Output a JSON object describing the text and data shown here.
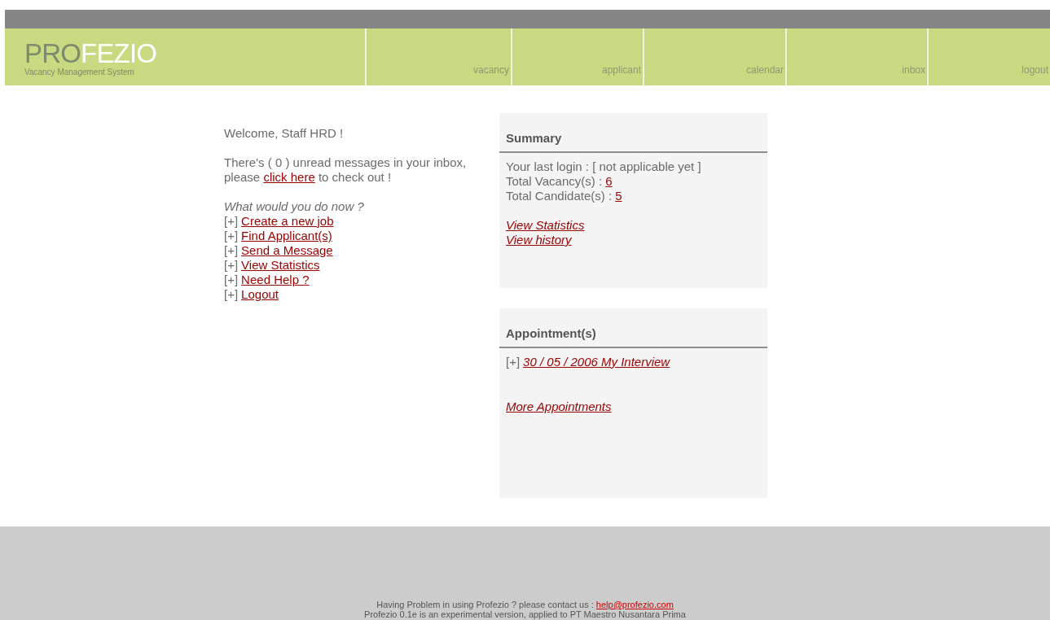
{
  "header": {
    "logo_dark": "PRO",
    "logo_light": "FEZIO",
    "subtitle": "Vacancy Management System",
    "nav": [
      {
        "label": "vacancy"
      },
      {
        "label": "applicant"
      },
      {
        "label": "calendar"
      },
      {
        "label": "inbox"
      },
      {
        "label": "logout"
      }
    ]
  },
  "welcome": "Welcome, Staff HRD !",
  "inbox_note": {
    "before": "There's ( 0 ) unread messages in your inbox, please ",
    "link": "click here",
    "after": " to check out !"
  },
  "actions_title": "What would you do now ?",
  "actions": [
    {
      "marker": "[+]",
      "label": "Create a new job"
    },
    {
      "marker": "[+]",
      "label": "Find Applicant(s)"
    },
    {
      "marker": "[+]",
      "label": "Send a Message"
    },
    {
      "marker": "[+]",
      "label": "View Statistics"
    },
    {
      "marker": "[+]",
      "label": "Need Help ?"
    },
    {
      "marker": "[+]",
      "label": "Logout"
    }
  ],
  "summary": {
    "title": "Summary",
    "last_login": "Your last login : [ not applicable yet ]",
    "stats": [
      {
        "label": "Total Vacancy(s) : ",
        "value": "6"
      },
      {
        "label": "Total Candidate(s) : ",
        "value": "5"
      }
    ],
    "links": [
      "View Statistics",
      "View history"
    ]
  },
  "appointments": {
    "title": "Appointment(s)",
    "items": [
      {
        "marker": "[+]",
        "label": "30 / 05 / 2006 My Interview"
      }
    ],
    "more": "More Appointments"
  },
  "footer": {
    "contact": "Having Problem in using Profezio ? please contact us : ",
    "email": "help@profezio.com",
    "note": "Profezio 0.1e is an experimental version, applied to PT Maestro Nusantara Prima"
  }
}
